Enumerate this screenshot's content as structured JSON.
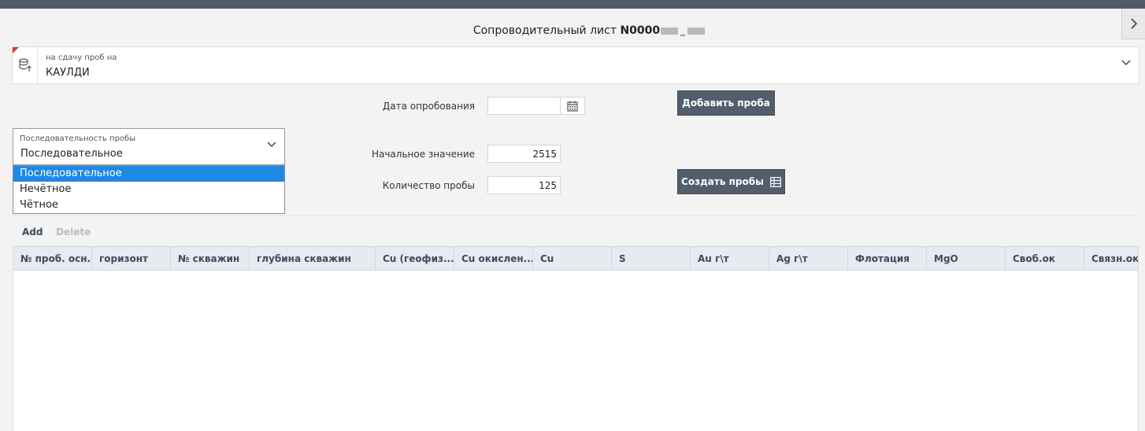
{
  "window": {
    "title_prefix": "Сопроводительный лист ",
    "title_number": "N0000"
  },
  "destination": {
    "label": "на сдачу проб на",
    "value": "КАУЛДИ"
  },
  "form": {
    "date_label": "Дата опробования",
    "date_value": "",
    "start_label": "Начальное значение",
    "start_value": "2515",
    "count_label": "Количество пробы",
    "count_value": "125",
    "add_sample_button": "Добавить проба",
    "create_samples_button": "Создать пробы"
  },
  "sequence": {
    "label": "Последовательность пробы",
    "value": "Последовательное",
    "options": [
      "Последовательное",
      "Нечётное",
      "Чётное"
    ],
    "selected_index": 0
  },
  "toolbar": {
    "add_label": "Add",
    "delete_label": "Delete"
  },
  "table": {
    "columns": [
      "№ проб. осн...",
      "горизонт",
      "№ скважин",
      "глубина скважин",
      "Cu (геофиз...",
      "Cu окислен...",
      "Cu",
      "S",
      "Au г\\т",
      "Ag г\\т",
      "Флотация",
      "MgO",
      "Своб.ок",
      "Связн.ок"
    ],
    "rows": []
  },
  "icons": {
    "side_toggle": "chevron-right-icon",
    "destination": "database-upload-icon",
    "dropdown": "chevron-down-icon",
    "calendar": "calendar-icon",
    "create": "table-grid-icon"
  },
  "colors": {
    "topbar": "#4f5a66",
    "button": "#525e6b",
    "selected_option": "#1e88e5",
    "required_marker": "#e53935",
    "grid_header": "#e6ebf1"
  }
}
